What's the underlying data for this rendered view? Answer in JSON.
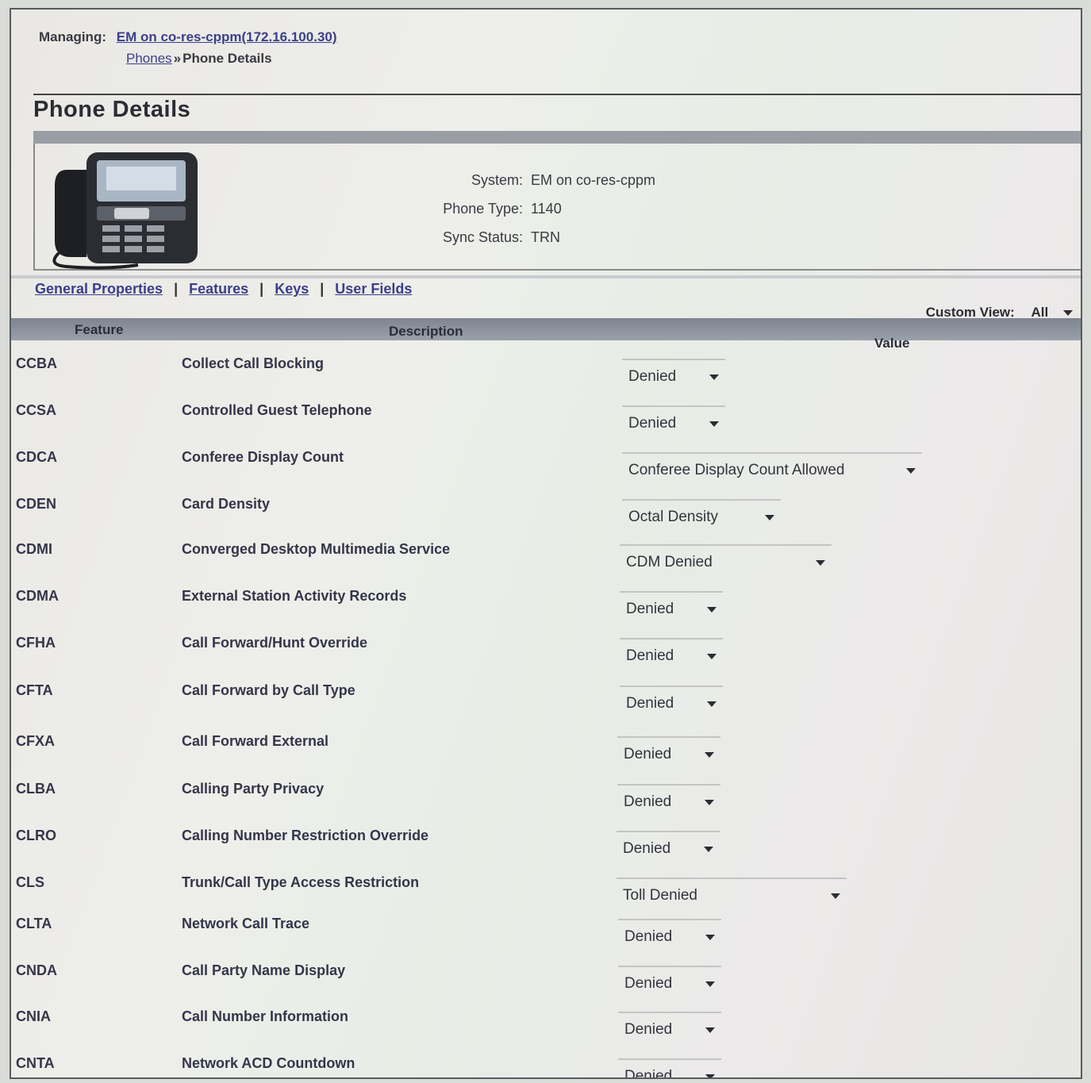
{
  "header": {
    "managing_label": "Managing:",
    "managing_value": "EM on co-res-cppm(172.16.100.30)",
    "breadcrumb_link": "Phones",
    "breadcrumb_sep": "»",
    "breadcrumb_current": "Phone Details",
    "page_title": "Phone Details"
  },
  "info": {
    "system_label": "System:",
    "system_value": "EM on co-res-cppm",
    "phone_type_label": "Phone Type:",
    "phone_type_value": "1140",
    "sync_status_label": "Sync Status:",
    "sync_status_value": "TRN"
  },
  "tabs": [
    "General Properties",
    "Features",
    "Keys",
    "User Fields"
  ],
  "custom_view": {
    "label": "Custom View:",
    "value": "All"
  },
  "table": {
    "headers": {
      "feature": "Feature",
      "description": "Description",
      "value": "Value"
    },
    "rows": [
      {
        "code": "CCBA",
        "description": "Collect Call Blocking",
        "value": "Denied"
      },
      {
        "code": "CCSA",
        "description": "Controlled Guest Telephone",
        "value": "Denied"
      },
      {
        "code": "CDCA",
        "description": "Conferee Display Count",
        "value": "Conferee Display Count Allowed"
      },
      {
        "code": "CDEN",
        "description": "Card Density",
        "value": "Octal Density"
      },
      {
        "code": "CDMI",
        "description": "Converged Desktop Multimedia Service",
        "value": "CDM Denied"
      },
      {
        "code": "CDMA",
        "description": "External Station Activity Records",
        "value": "Denied"
      },
      {
        "code": "CFHA",
        "description": "Call Forward/Hunt Override",
        "value": "Denied"
      },
      {
        "code": "CFTA",
        "description": "Call Forward by Call Type",
        "value": "Denied"
      },
      {
        "code": "CFXA",
        "description": "Call Forward External",
        "value": "Denied"
      },
      {
        "code": "CLBA",
        "description": "Calling Party Privacy",
        "value": "Denied"
      },
      {
        "code": "CLRO",
        "description": "Calling Number Restriction Override",
        "value": "Denied"
      },
      {
        "code": "CLS",
        "description": "Trunk/Call Type Access Restriction",
        "value": "Toll Denied"
      },
      {
        "code": "CLTA",
        "description": "Network Call Trace",
        "value": "Denied"
      },
      {
        "code": "CNDA",
        "description": "Call Party Name Display",
        "value": "Denied"
      },
      {
        "code": "CNIA",
        "description": "Call Number Information",
        "value": "Denied"
      },
      {
        "code": "CNTA",
        "description": "Network ACD Countdown",
        "value": "Denied"
      }
    ]
  }
}
